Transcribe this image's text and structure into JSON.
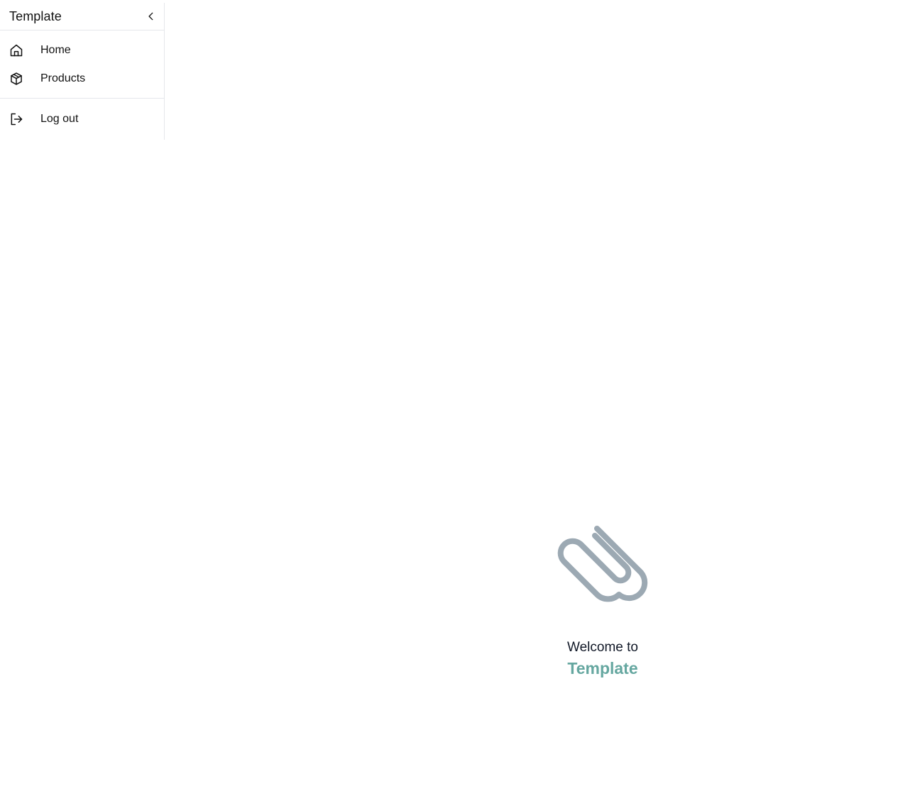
{
  "sidebar": {
    "title": "Template",
    "collapse_icon": "chevron-left-icon",
    "nav_items": [
      {
        "label": "Home",
        "icon": "home-icon"
      },
      {
        "label": "Products",
        "icon": "package-icon"
      }
    ],
    "footer_items": [
      {
        "label": "Log out",
        "icon": "log-out-icon"
      }
    ]
  },
  "main": {
    "illustration_icon": "paperclip-icon",
    "welcome_text": "Welcome to",
    "app_name": "Template"
  },
  "colors": {
    "accent": "#65a7a0",
    "illustration": "#9ca9b3",
    "border": "#e5e7eb"
  }
}
